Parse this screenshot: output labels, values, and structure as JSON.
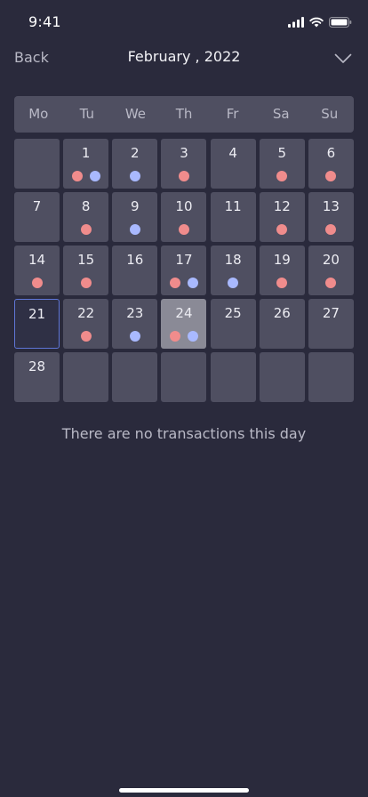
{
  "status": {
    "time": "9:41"
  },
  "nav": {
    "back_label": "Back",
    "month_label": "February , 2022"
  },
  "weekdays": [
    "Mo",
    "Tu",
    "We",
    "Th",
    "Fr",
    "Sa",
    "Su"
  ],
  "calendar": {
    "days": [
      {
        "label": "",
        "dots": []
      },
      {
        "label": "1",
        "dots": [
          "red",
          "blue"
        ]
      },
      {
        "label": "2",
        "dots": [
          "blue"
        ]
      },
      {
        "label": "3",
        "dots": [
          "red"
        ]
      },
      {
        "label": "4",
        "dots": []
      },
      {
        "label": "5",
        "dots": [
          "red"
        ]
      },
      {
        "label": "6",
        "dots": [
          "red"
        ]
      },
      {
        "label": "7",
        "dots": []
      },
      {
        "label": "8",
        "dots": [
          "red"
        ]
      },
      {
        "label": "9",
        "dots": [
          "blue"
        ]
      },
      {
        "label": "10",
        "dots": [
          "red"
        ]
      },
      {
        "label": "11",
        "dots": []
      },
      {
        "label": "12",
        "dots": [
          "red"
        ]
      },
      {
        "label": "13",
        "dots": [
          "red"
        ]
      },
      {
        "label": "14",
        "dots": [
          "red"
        ]
      },
      {
        "label": "15",
        "dots": [
          "red"
        ]
      },
      {
        "label": "16",
        "dots": []
      },
      {
        "label": "17",
        "dots": [
          "red",
          "blue"
        ]
      },
      {
        "label": "18",
        "dots": [
          "blue"
        ]
      },
      {
        "label": "19",
        "dots": [
          "red"
        ]
      },
      {
        "label": "20",
        "dots": [
          "red"
        ]
      },
      {
        "label": "21",
        "dots": [],
        "state": "today"
      },
      {
        "label": "22",
        "dots": [
          "red"
        ]
      },
      {
        "label": "23",
        "dots": [
          "blue"
        ]
      },
      {
        "label": "24",
        "dots": [
          "red",
          "blue"
        ],
        "state": "selected"
      },
      {
        "label": "25",
        "dots": []
      },
      {
        "label": "26",
        "dots": []
      },
      {
        "label": "27",
        "dots": []
      },
      {
        "label": "28",
        "dots": []
      },
      {
        "label": "",
        "dots": []
      },
      {
        "label": "",
        "dots": []
      },
      {
        "label": "",
        "dots": []
      },
      {
        "label": "",
        "dots": []
      },
      {
        "label": "",
        "dots": []
      },
      {
        "label": "",
        "dots": []
      }
    ]
  },
  "empty_message": "There are no transactions this day",
  "colors": {
    "background": "#2a2a3c",
    "cell": "#4f4f61",
    "today_border": "#5f76d6",
    "selected": "#8a8a96",
    "dot_red": "#f08c8c",
    "dot_blue": "#a9b9ff"
  },
  "icons": {
    "signal": "cellular-signal-icon",
    "wifi": "wifi-icon",
    "battery": "battery-icon",
    "dropdown": "chevron-down-icon"
  }
}
